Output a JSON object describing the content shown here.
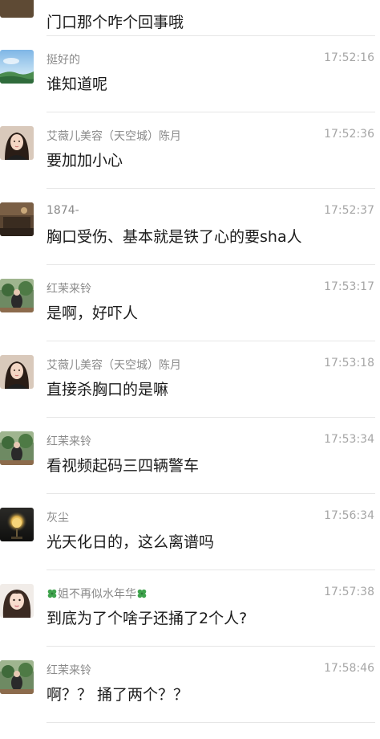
{
  "messages": [
    {
      "id": "top",
      "sender": "",
      "time": "",
      "text": "门口那个咋个回事哦",
      "avatar": "none"
    },
    {
      "id": "m1",
      "sender": "挺好的",
      "time": "17:52:16",
      "text": "谁知道呢",
      "avatar": "sky-landscape"
    },
    {
      "id": "m2",
      "sender": "艾薇儿美容（天空城）陈月",
      "time": "17:52:36",
      "text": "要加加小心",
      "avatar": "woman-portrait"
    },
    {
      "id": "m3",
      "sender": "1874-",
      "time": "17:52:37",
      "text": "胸口受伤、基本就是铁了心的要sha人",
      "avatar": "dim-room"
    },
    {
      "id": "m4",
      "sender": "红茉来铃",
      "time": "17:53:17",
      "text": "是啊，好吓人",
      "avatar": "garden-scene"
    },
    {
      "id": "m5",
      "sender": "艾薇儿美容（天空城）陈月",
      "time": "17:53:18",
      "text": "直接杀胸口的是嘛",
      "avatar": "woman-portrait"
    },
    {
      "id": "m6",
      "sender": "红茉来铃",
      "time": "17:53:34",
      "text": "看视频起码三四辆警车",
      "avatar": "garden-scene"
    },
    {
      "id": "m7",
      "sender": "灰尘",
      "time": "17:56:34",
      "text": "光天化日的，这么离谱吗",
      "avatar": "lamp-dark"
    },
    {
      "id": "m8",
      "sender": "姐不再似水年华",
      "time": "17:57:38",
      "text": "到底为了个啥子还捅了2个人?",
      "avatar": "girl-portrait"
    },
    {
      "id": "m9",
      "sender": "红茉来铃",
      "time": "17:58:46",
      "text": "啊？？ 捅了两个？？",
      "avatar": "garden-scene"
    }
  ],
  "colors": {
    "sender": "#8a8a8a",
    "time": "#a6a6a6",
    "text": "#1b1b1b",
    "divider": "#e6e6e6",
    "clover": "#3fa34d"
  },
  "icons": {
    "clover": "four-leaf-clover-icon"
  }
}
